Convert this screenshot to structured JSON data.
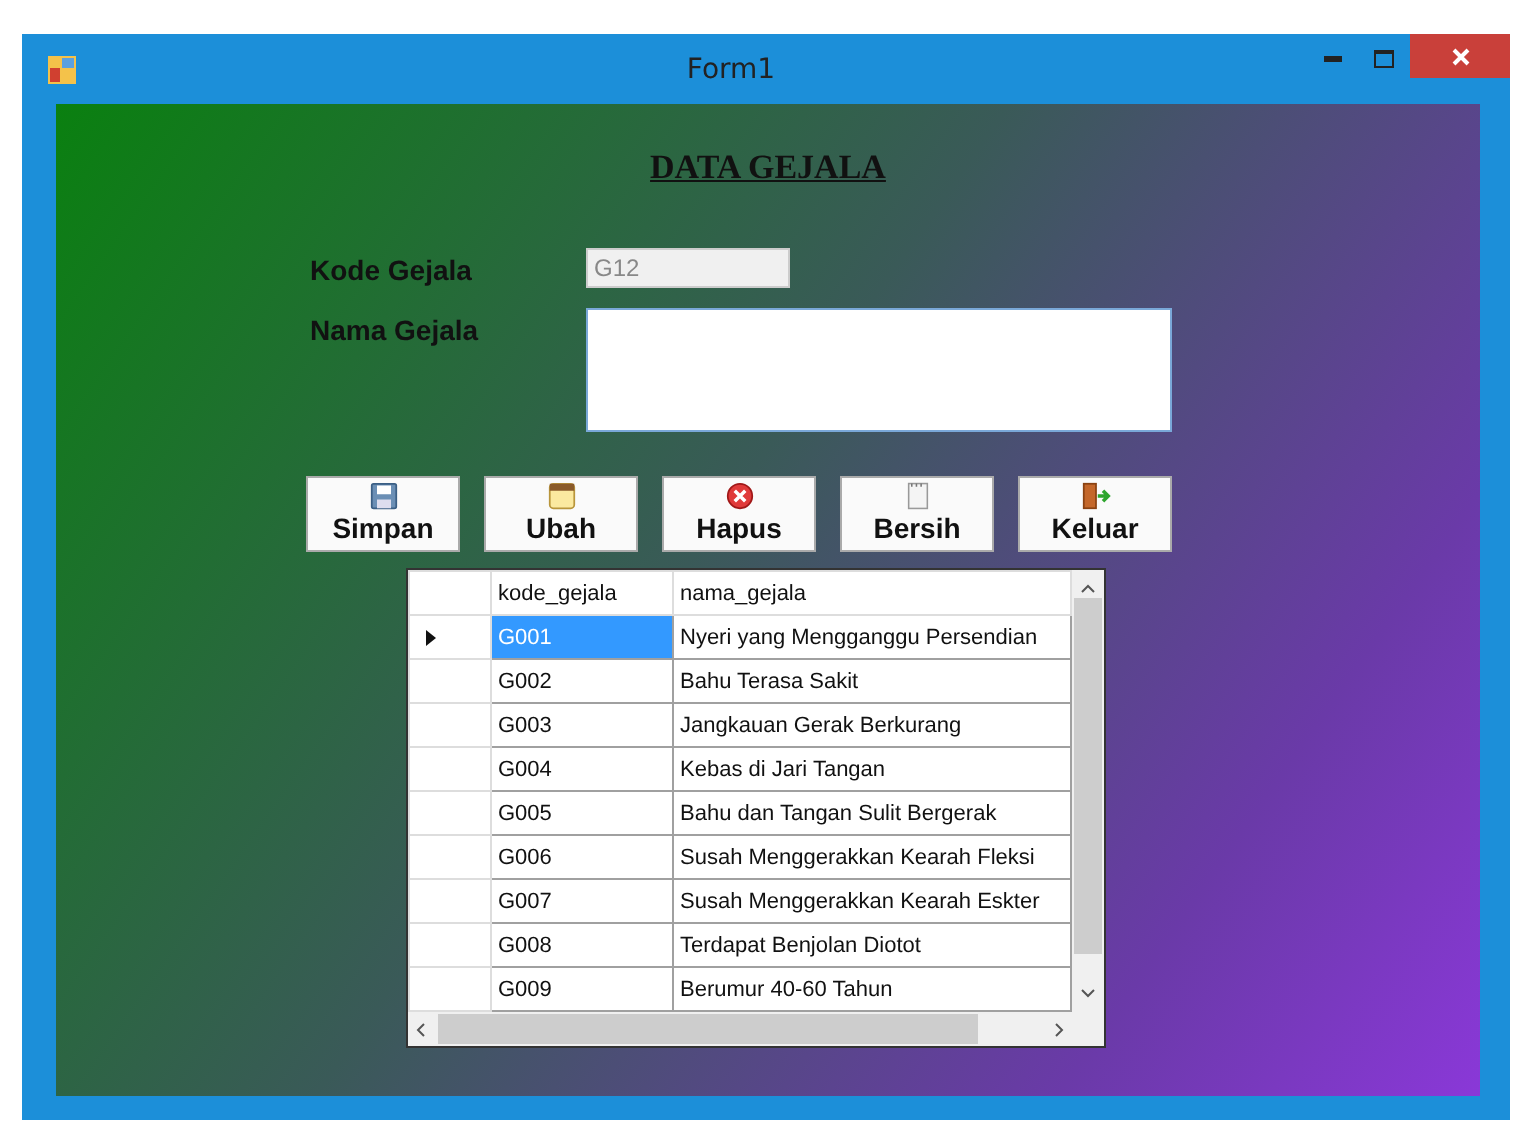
{
  "window": {
    "title": "Form1"
  },
  "heading": "DATA GEJALA",
  "fields": [
    {
      "label": "Kode Gejala",
      "value": "G12",
      "disabled": true,
      "kind": "line"
    },
    {
      "label": "Nama Gejala",
      "disabled": false,
      "kind": "area"
    }
  ],
  "buttons": [
    {
      "label": "Simpan",
      "kind": "save"
    },
    {
      "label": "Ubah",
      "kind": "edit"
    },
    {
      "label": "Hapus",
      "kind": "delete"
    },
    {
      "label": "Bersih",
      "kind": "clear"
    },
    {
      "label": "Keluar",
      "kind": "exit"
    }
  ],
  "table": {
    "columns": [
      "kode_gejala",
      "nama_gejala"
    ],
    "rows": [
      {
        "cells": [
          "G001",
          "Nyeri yang Mengganggu Persendian"
        ],
        "selected": true
      },
      {
        "cells": [
          "G002",
          "Bahu Terasa Sakit"
        ],
        "selected": false
      },
      {
        "cells": [
          "G003",
          "Jangkauan Gerak Berkurang"
        ],
        "selected": false
      },
      {
        "cells": [
          "G004",
          "Kebas di Jari Tangan"
        ],
        "selected": false
      },
      {
        "cells": [
          "G005",
          "Bahu dan Tangan Sulit Bergerak"
        ],
        "selected": false
      },
      {
        "cells": [
          "G006",
          "Susah Menggerakkan Kearah Fleksi"
        ],
        "selected": false
      },
      {
        "cells": [
          "G007",
          "Susah Menggerakkan Kearah Eskter"
        ],
        "selected": false
      },
      {
        "cells": [
          "G008",
          "Terdapat Benjolan Diotot"
        ],
        "selected": false
      },
      {
        "cells": [
          "G009",
          "Berumur 40-60 Tahun"
        ],
        "selected": false
      }
    ]
  }
}
